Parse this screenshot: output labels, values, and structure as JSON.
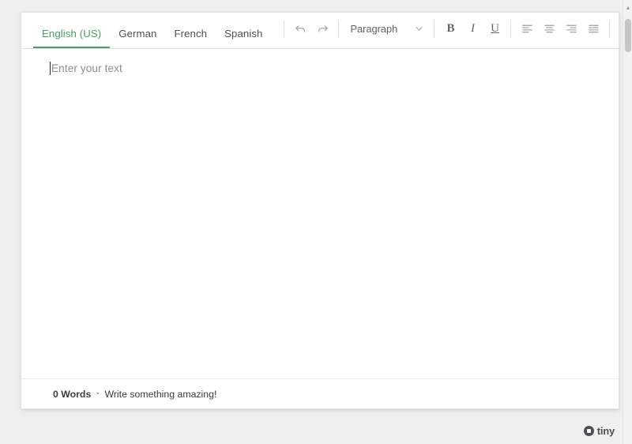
{
  "editor": {
    "tabs": [
      {
        "label": "English (US)",
        "active": true
      },
      {
        "label": "German",
        "active": false
      },
      {
        "label": "French",
        "active": false
      },
      {
        "label": "Spanish",
        "active": false
      }
    ],
    "toolbar": {
      "undo_label": "Undo",
      "redo_label": "Redo",
      "format_select_value": "Paragraph",
      "bold_label": "B",
      "italic_label": "I",
      "underline_label": "U",
      "align_left_label": "Align left",
      "align_center_label": "Align center",
      "align_right_label": "Align right",
      "align_justify_label": "Justify"
    },
    "content": {
      "placeholder": "Enter your text",
      "value": ""
    },
    "status": {
      "word_count": "0 Words",
      "separator": "•",
      "message": "Write something amazing!"
    }
  },
  "branding": {
    "name": "tiny"
  },
  "scrollbar": {
    "up_arrow": "▲"
  },
  "colors": {
    "accent_green": "#4a9d63",
    "page_background": "#f0f0f0",
    "panel_background": "#ffffff",
    "border": "#e3e3e3",
    "muted_text": "#8a8f94"
  }
}
